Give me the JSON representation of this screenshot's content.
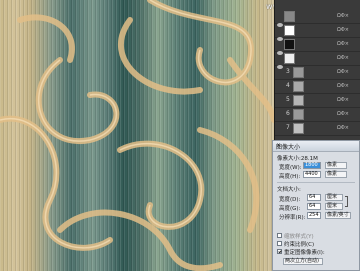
{
  "watermark": "www.huitu.com",
  "layers": [
    {
      "num": "",
      "name": "",
      "info": "ΩΦ×"
    },
    {
      "num": "",
      "name": "",
      "info": "ΩΦ×"
    },
    {
      "num": "",
      "name": "",
      "info": "ΩΦ×"
    },
    {
      "num": "",
      "name": "",
      "info": "ΩΦ×"
    },
    {
      "num": "3",
      "name": "",
      "info": "ΩΦ×"
    },
    {
      "num": "4",
      "name": "",
      "info": "ΩΦ×"
    },
    {
      "num": "5",
      "name": "",
      "info": "ΩΦ×"
    },
    {
      "num": "6",
      "name": "",
      "info": "ΩΦ×"
    },
    {
      "num": "7",
      "name": "",
      "info": "ΩΦ×"
    }
  ],
  "dialog": {
    "title": "图像大小",
    "close": "×",
    "pixel_dims": "像素大小:28.1M",
    "width_label": "宽度(W):",
    "width_value": "1800",
    "width_unit": "像素",
    "height_label": "高度(H):",
    "height_value": "4400",
    "height_unit": "像素",
    "doc_size": "文档大小:",
    "doc_width_label": "宽度(D):",
    "doc_width_value": "64",
    "doc_width_unit": "厘米",
    "doc_height_label": "高度(G):",
    "doc_height_value": "64",
    "doc_height_unit": "厘米",
    "resolution_label": "分辨率(R):",
    "resolution_value": "254",
    "resolution_unit": "像素/英寸",
    "scale_styles": "缩放样式(Y)",
    "constrain": "约束比例(C)",
    "resample": "重定图像像素(I):",
    "resample_method": "两次立方(自动)"
  },
  "colors": {
    "panel_bg": "#3a3a3a",
    "dialog_bg": "#d9dde3",
    "selection": "#3b8fd9",
    "swirl": "#e2bd86"
  }
}
